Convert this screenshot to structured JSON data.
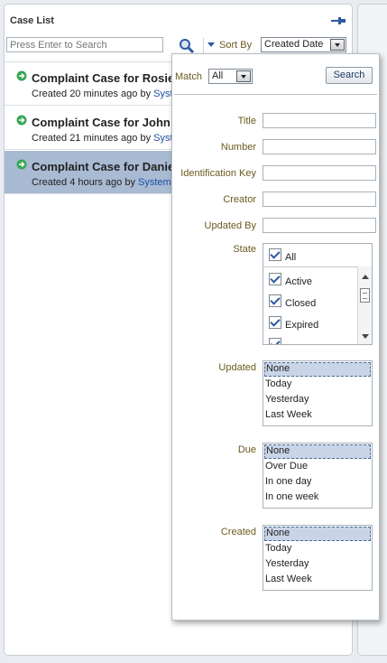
{
  "panel": {
    "title": "Case List",
    "search_placeholder": "Press Enter to Search",
    "sort_by_label": "Sort By",
    "sort_by_value": "Created Date"
  },
  "cases": [
    {
      "title": "Complaint Case for Rosie",
      "meta": "Created 20 minutes ago by ",
      "creator": "Syste"
    },
    {
      "title": "Complaint Case for John",
      "meta": "Created 21 minutes ago by ",
      "creator": "Syste"
    },
    {
      "title": "Complaint Case for Danie",
      "meta": "Created 4 hours ago by ",
      "creator": "System"
    }
  ],
  "filter": {
    "match_label": "Match",
    "match_value": "All",
    "search_button": "Search",
    "fields": {
      "title": "Title",
      "number": "Number",
      "identification_key": "Identification Key",
      "creator": "Creator",
      "updated_by": "Updated By"
    },
    "state": {
      "label": "State",
      "all_label": "All",
      "options": [
        "Active",
        "Closed",
        "Expired"
      ]
    },
    "updated": {
      "label": "Updated",
      "options": [
        "None",
        "Today",
        "Yesterday",
        "Last Week"
      ]
    },
    "due": {
      "label": "Due",
      "options": [
        "None",
        "Over Due",
        "In one day",
        "In one week"
      ]
    },
    "created": {
      "label": "Created",
      "options": [
        "None",
        "Today",
        "Yesterday",
        "Last Week"
      ]
    }
  },
  "colors": {
    "selected_row": "#a9bad3",
    "label_text": "#6a5a1e",
    "link": "#1e4fa3",
    "status_icon": "#3aa655"
  }
}
